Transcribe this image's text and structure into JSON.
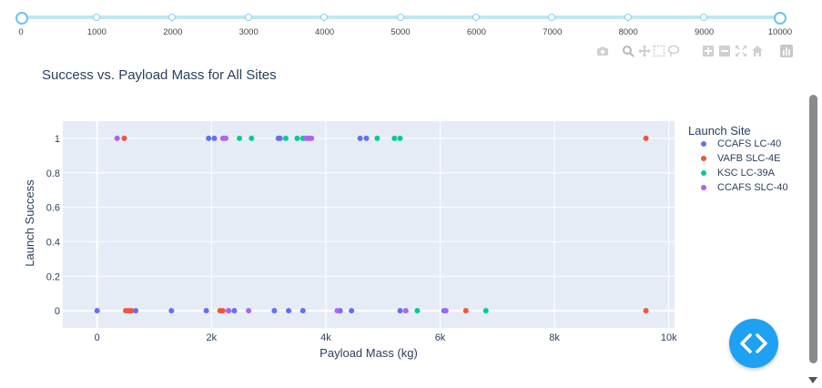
{
  "range_slider": {
    "ticks": [
      "0",
      "1000",
      "2000",
      "3000",
      "4000",
      "5000",
      "6000",
      "7000",
      "8000",
      "9000",
      "10000"
    ],
    "min": 0,
    "max": 10000,
    "selected": [
      0,
      10000
    ]
  },
  "modebar": {
    "icons": [
      "camera-icon",
      "zoom-icon",
      "pan-icon",
      "box-select-icon",
      "lasso-select-icon",
      "zoom-in-icon",
      "zoom-out-icon",
      "autoscale-icon",
      "reset-axes-icon",
      "plotly-logo-icon"
    ]
  },
  "code_button": {
    "icon": "code-icon",
    "color": "#1ea1f2"
  },
  "chart_data": {
    "type": "scatter",
    "title": "Success vs. Payload Mass for All Sites",
    "xlabel": "Payload Mass (kg)",
    "ylabel": "Launch Success",
    "xlim": [
      -600,
      10100
    ],
    "ylim": [
      -0.1,
      1.1
    ],
    "x_ticks": [
      0,
      2000,
      4000,
      6000,
      8000,
      10000
    ],
    "x_tick_labels": [
      "0",
      "2k",
      "4k",
      "6k",
      "8k",
      "10k"
    ],
    "y_ticks": [
      0,
      0.2,
      0.4,
      0.6,
      0.8,
      1
    ],
    "y_tick_labels": [
      "0",
      "0.2",
      "0.4",
      "0.6",
      "0.8",
      "1"
    ],
    "grid": true,
    "legend_title": "Launch Site",
    "legend_position": "right",
    "series": [
      {
        "name": "CCAFS LC-40",
        "color": "#636efa",
        "x": [
          0,
          675,
          1300,
          1910,
          1950,
          2050,
          2300,
          2400,
          3100,
          3170,
          3200,
          3350,
          3600,
          4250,
          4450,
          4600,
          4710,
          5300,
          6070
        ],
        "y": [
          0,
          0,
          0,
          0,
          1,
          1,
          0,
          0,
          0,
          1,
          1,
          0,
          0,
          0,
          0,
          1,
          1,
          0,
          0
        ]
      },
      {
        "name": "VAFB SLC-4E",
        "color": "#EF553B",
        "x": [
          475,
          500,
          550,
          600,
          2150,
          2200,
          6450,
          9600,
          9600
        ],
        "y": [
          1,
          0,
          0,
          0,
          0,
          0,
          0,
          1,
          0
        ]
      },
      {
        "name": "KSC LC-39A",
        "color": "#00cc96",
        "x": [
          2490,
          2700,
          3300,
          3500,
          3600,
          3700,
          4900,
          5200,
          5300,
          5600,
          6800
        ],
        "y": [
          1,
          1,
          1,
          1,
          1,
          1,
          1,
          1,
          1,
          0,
          0
        ]
      },
      {
        "name": "CCAFS SLC-40",
        "color": "#ab63fa",
        "x": [
          350,
          2200,
          2250,
          2300,
          2650,
          3650,
          3700,
          3750,
          4200,
          5400,
          6100
        ],
        "y": [
          1,
          1,
          1,
          0,
          0,
          1,
          1,
          1,
          0,
          0,
          0
        ]
      }
    ]
  }
}
